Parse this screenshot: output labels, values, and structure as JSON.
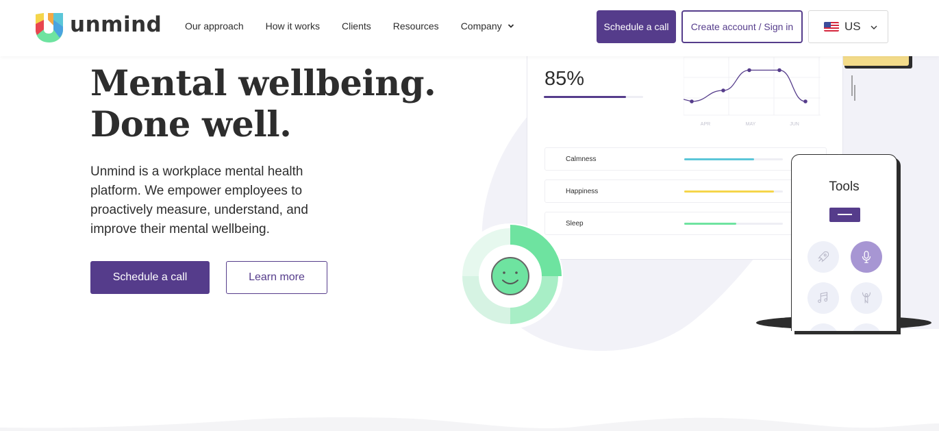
{
  "brand": {
    "name": "unmind",
    "accent": "#553c8b"
  },
  "nav": {
    "items": [
      {
        "label": "Our approach"
      },
      {
        "label": "How it works"
      },
      {
        "label": "Clients"
      },
      {
        "label": "Resources"
      },
      {
        "label": "Company",
        "has_dropdown": true
      }
    ]
  },
  "header_actions": {
    "schedule_label": "Schedule a call",
    "account_label": "Create account / Sign in",
    "locale": {
      "selected": "US",
      "flag": "us-flag-icon"
    }
  },
  "hero": {
    "title_line1": "Mental wellbeing.",
    "title_line2": "Done well.",
    "description": "Unmind is a workplace mental health platform. We empower employees to proactively measure, understand, and improve their mental wellbeing.",
    "primary_cta": "Schedule a call",
    "secondary_cta": "Learn more"
  },
  "illustration": {
    "score": {
      "value": "85%",
      "progress": 0.83
    },
    "trend_chart": {
      "x_labels": [
        "APR",
        "MAY",
        "JUN"
      ],
      "points": [
        0.35,
        0.55,
        0.92,
        0.92,
        0.35
      ],
      "color": "#553c8b"
    },
    "metrics": [
      {
        "label": "Calmness",
        "value": 0.71,
        "color": "#5bc6d8"
      },
      {
        "label": "Happiness",
        "value": 0.91,
        "color": "#f5d54a"
      },
      {
        "label": "Sleep",
        "value": 0.53,
        "color": "#6ee3a0"
      }
    ],
    "mood_icon": "smiley-face-icon",
    "phone": {
      "title": "Tools",
      "tools": [
        {
          "icon": "rocket-icon",
          "active": false
        },
        {
          "icon": "microphone-icon",
          "active": true
        },
        {
          "icon": "music-note-icon",
          "active": false
        },
        {
          "icon": "yoga-person-icon",
          "active": false
        }
      ]
    }
  }
}
